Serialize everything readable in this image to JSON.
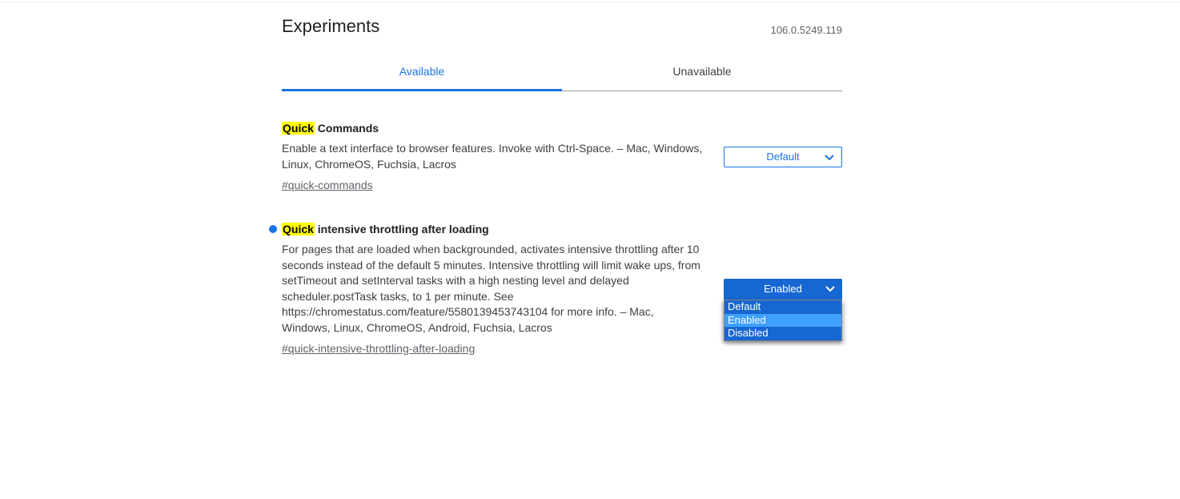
{
  "page": {
    "title": "Experiments",
    "version": "106.0.5249.119"
  },
  "tabs": [
    {
      "label": "Available",
      "active": true
    },
    {
      "label": "Unavailable",
      "active": false
    }
  ],
  "experiments": [
    {
      "name_highlight": "Quick",
      "name_rest": " Commands",
      "description": "Enable a text interface to browser features. Invoke with Ctrl-Space. – Mac, Windows, Linux, ChromeOS, Fuchsia, Lacros",
      "permalink": "#quick-commands",
      "modified": false,
      "control": {
        "type": "dropdown",
        "state": "closed",
        "value": "Default"
      }
    },
    {
      "name_highlight": "Quick",
      "name_rest": " intensive throttling after loading",
      "description": "For pages that are loaded when backgrounded, activates intensive throttling after 10 seconds instead of the default 5 minutes. Intensive throttling will limit wake ups, from setTimeout and setInterval tasks with a high nesting level and delayed scheduler.postTask tasks, to 1 per minute. See https://chromestatus.com/feature/5580139453743104 for more info. – Mac, Windows, Linux, ChromeOS, Android, Fuchsia, Lacros",
      "permalink": "#quick-intensive-throttling-after-loading",
      "modified": true,
      "control": {
        "type": "dropdown",
        "state": "open",
        "value": "Enabled",
        "options": [
          "Default",
          "Enabled",
          "Disabled"
        ],
        "selected_option": "Enabled"
      }
    }
  ],
  "colors": {
    "accent_blue": "#1a73e8",
    "search_highlight": "#ffff00",
    "open_select_bg": "#1767d2",
    "option_selected_bg": "#3ea0ff",
    "title_text": "#202124",
    "secondary_text": "#5f6368"
  },
  "icons": {
    "chevron_down": "chevron-down-icon"
  }
}
